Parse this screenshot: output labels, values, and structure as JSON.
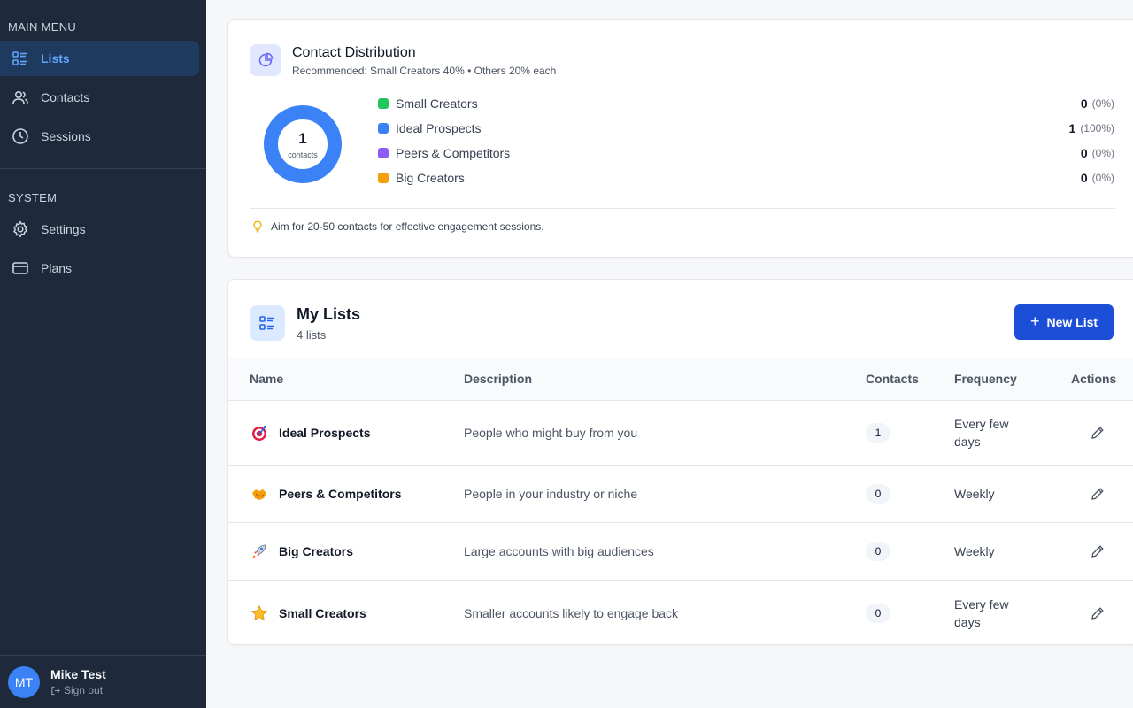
{
  "sidebar": {
    "main_menu_label": "MAIN MENU",
    "system_label": "SYSTEM",
    "main_items": [
      {
        "label": "Lists",
        "icon": "list-icon",
        "active": true
      },
      {
        "label": "Contacts",
        "icon": "users-icon",
        "active": false
      },
      {
        "label": "Sessions",
        "icon": "clock-icon",
        "active": false
      }
    ],
    "system_items": [
      {
        "label": "Settings",
        "icon": "gear-icon"
      },
      {
        "label": "Plans",
        "icon": "credit-card-icon"
      }
    ],
    "user": {
      "initials": "MT",
      "name": "Mike Test",
      "signout": "Sign out"
    }
  },
  "distribution": {
    "title": "Contact Distribution",
    "subtitle": "Recommended: Small Creators 40% • Others 20% each",
    "total": "1",
    "total_label": "contacts",
    "legend": [
      {
        "name": "Small Creators",
        "color": "#22c55e",
        "count": "0",
        "pct": "(0%)"
      },
      {
        "name": "Ideal Prospects",
        "color": "#3b82f6",
        "count": "1",
        "pct": "(100%)"
      },
      {
        "name": "Peers & Competitors",
        "color": "#8b5cf6",
        "count": "0",
        "pct": "(0%)"
      },
      {
        "name": "Big Creators",
        "color": "#f59e0b",
        "count": "0",
        "pct": "(0%)"
      }
    ],
    "tip": "Aim for 20-50 contacts for effective engagement sessions."
  },
  "lists": {
    "title": "My Lists",
    "count": "4 lists",
    "new_button": "New List",
    "columns": {
      "name": "Name",
      "description": "Description",
      "contacts": "Contacts",
      "frequency": "Frequency",
      "actions": "Actions"
    },
    "rows": [
      {
        "name": "Ideal Prospects",
        "icon": "target-icon",
        "description": "People who might buy from you",
        "contacts": "1",
        "frequency": "Every few days"
      },
      {
        "name": "Peers & Competitors",
        "icon": "handshake-icon",
        "description": "People in your industry or niche",
        "contacts": "0",
        "frequency": "Weekly"
      },
      {
        "name": "Big Creators",
        "icon": "rocket-icon",
        "description": "Large accounts with big audiences",
        "contacts": "0",
        "frequency": "Weekly"
      },
      {
        "name": "Small Creators",
        "icon": "star-icon",
        "description": "Smaller accounts likely to engage back",
        "contacts": "0",
        "frequency": "Every few days"
      }
    ]
  },
  "colors": {
    "sidebar_bg": "#1e293b",
    "accent": "#1d4ed8",
    "active_text": "#60a5fa"
  }
}
